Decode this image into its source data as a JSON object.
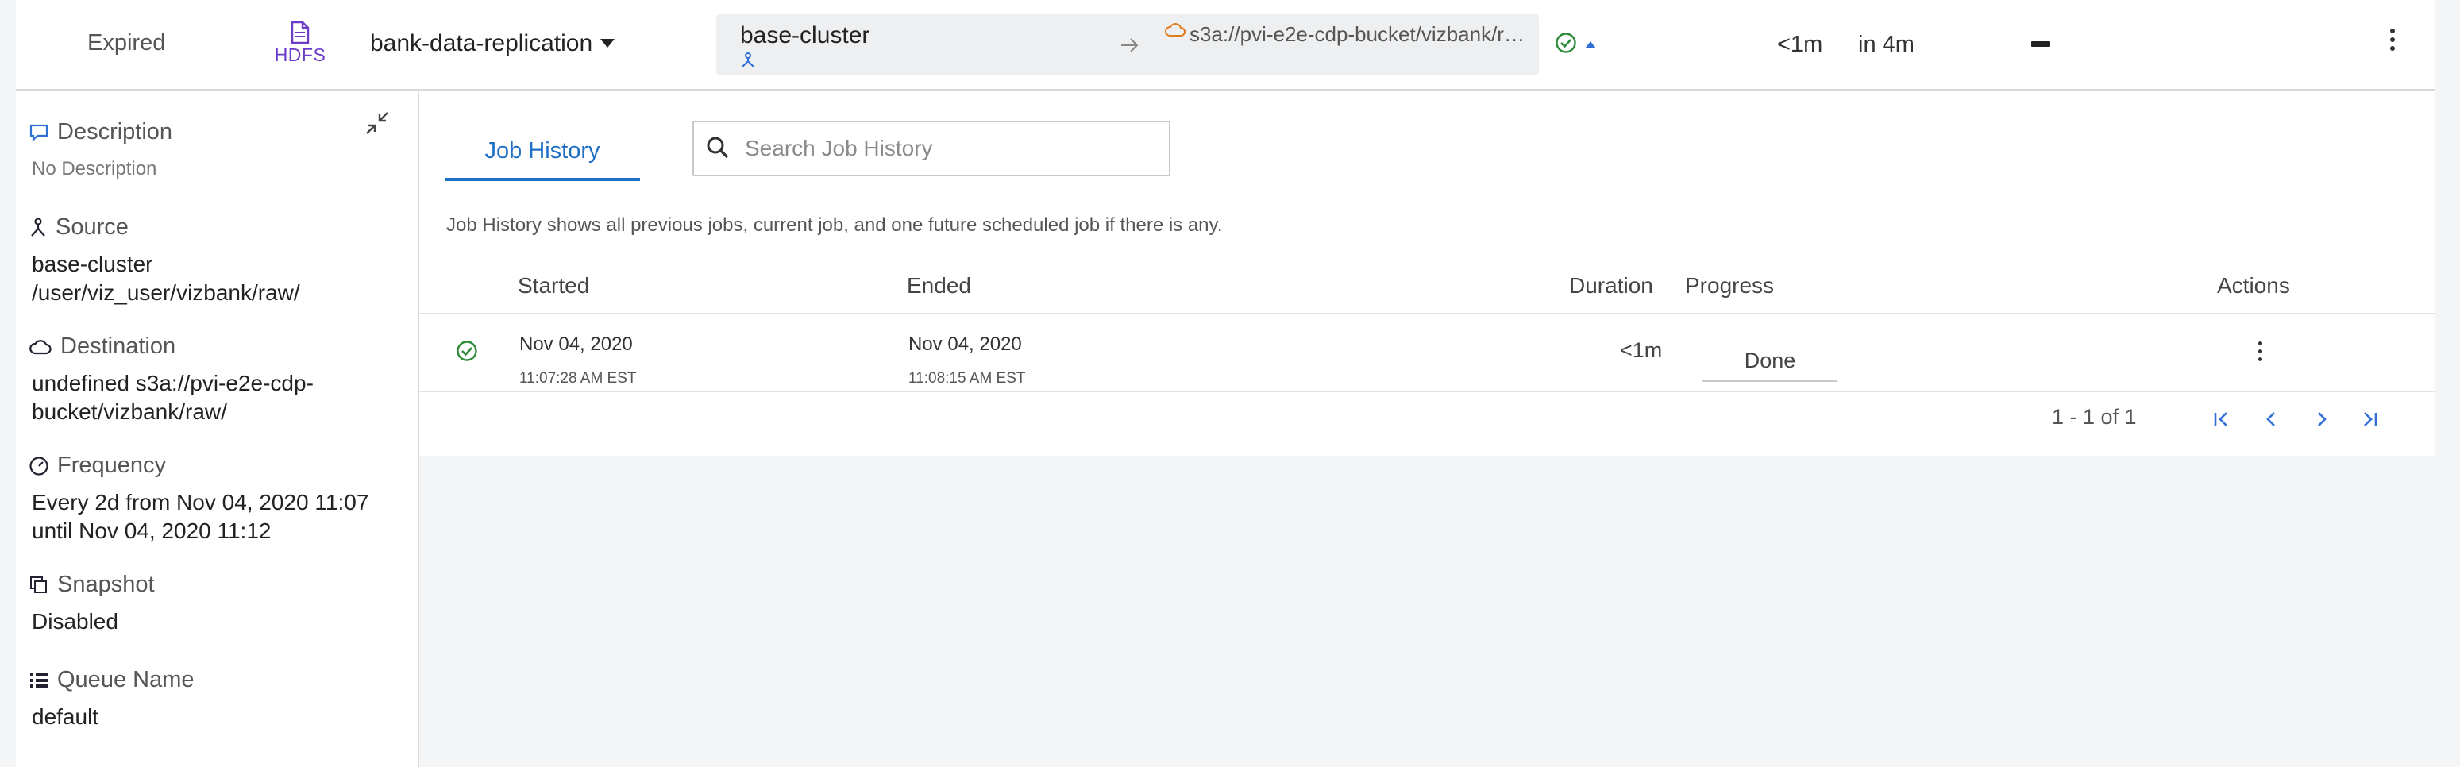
{
  "policy_row": {
    "status": "Expired",
    "type_label": "HDFS",
    "policy_name": "bank-data-replication",
    "source_cluster": "base-cluster",
    "destination_path": "s3a://pvi-e2e-cdp-bucket/vizbank/ra...",
    "last_duration": "<1m",
    "next_run": "in 4m"
  },
  "info_panel": {
    "description": {
      "label": "Description",
      "value": "No Description"
    },
    "source": {
      "label": "Source",
      "lines": [
        "base-cluster",
        "/user/viz_user/vizbank/raw/"
      ]
    },
    "destination": {
      "label": "Destination",
      "lines": [
        "undefined s3a://pvi-e2e-cdp-",
        "bucket/vizbank/raw/"
      ]
    },
    "frequency": {
      "label": "Frequency",
      "lines": [
        "Every 2d from Nov 04, 2020 11:07",
        "until Nov 04, 2020 11:12"
      ]
    },
    "snapshot": {
      "label": "Snapshot",
      "value": "Disabled"
    },
    "queue": {
      "label": "Queue Name",
      "value": "default"
    }
  },
  "job_history": {
    "tab_label": "Job History",
    "search_placeholder": "Search Job History",
    "help_text": "Job History shows all previous jobs, current job, and one future scheduled job if there is any.",
    "columns": {
      "started": "Started",
      "ended": "Ended",
      "duration": "Duration",
      "progress": "Progress",
      "actions": "Actions"
    },
    "rows": [
      {
        "started_date": "Nov 04, 2020",
        "started_time": "11:07:28 AM EST",
        "ended_date": "Nov 04, 2020",
        "ended_time": "11:08:15 AM EST",
        "duration": "<1m",
        "progress": "Done"
      }
    ],
    "pagination": "1 - 1 of 1"
  },
  "icons": {
    "hdfs": "file-icon",
    "status_ok": "check-circle-icon",
    "destination": "cloud-icon",
    "source": "cluster-node-icon"
  },
  "colors": {
    "accent": "#1f6fc5",
    "success": "#2e8b3a",
    "hdfs": "#6a3cc9",
    "cloud": "#e07b1f"
  }
}
